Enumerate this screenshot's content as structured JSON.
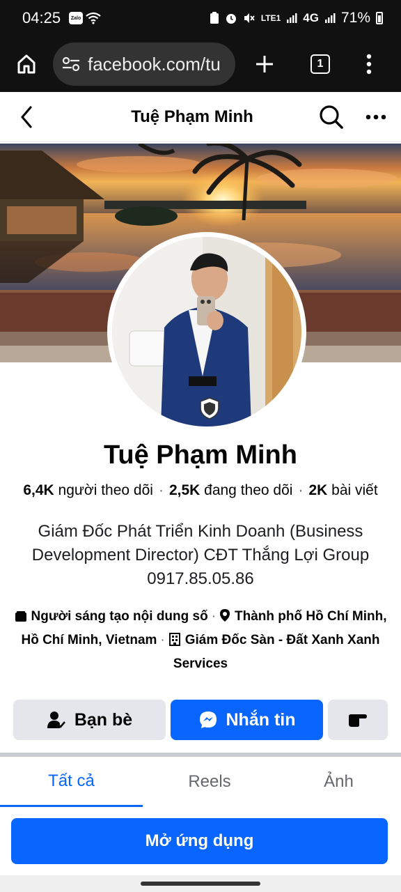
{
  "status_bar": {
    "time": "04:25",
    "zalo_label": "Zalo",
    "network": "4G",
    "lte_label": "LTE1",
    "battery": "71%"
  },
  "browser": {
    "url": "facebook.com/tu",
    "tab_count": "1"
  },
  "header": {
    "title": "Tuệ Phạm Minh"
  },
  "profile": {
    "name": "Tuệ Phạm Minh",
    "followers_count": "6,4K",
    "followers_label": "người theo dõi",
    "following_count": "2,5K",
    "following_label": "đang theo dõi",
    "posts_count": "2K",
    "posts_label": "bài viết",
    "bio": "Giám Đốc Phát Triển Kinh Doanh (Business Development Director) CĐT Thắng Lợi Group 0917.85.05.86",
    "detail_creator": "Người sáng tạo nội dung số",
    "detail_location": "Thành phố Hồ Chí Minh, Hồ Chí Minh, Vietnam",
    "detail_work": "Giám Đốc Sàn - Đất Xanh Xanh Services"
  },
  "actions": {
    "friends_label": "Bạn bè",
    "message_label": "Nhắn tin"
  },
  "tabs": {
    "all": "Tất cả",
    "reels": "Reels",
    "photos": "Ảnh"
  },
  "open_app_label": "Mở ứng dụng",
  "colors": {
    "accent": "#0866ff",
    "button_gray": "#e4e6eb",
    "status_bg": "#111111"
  }
}
